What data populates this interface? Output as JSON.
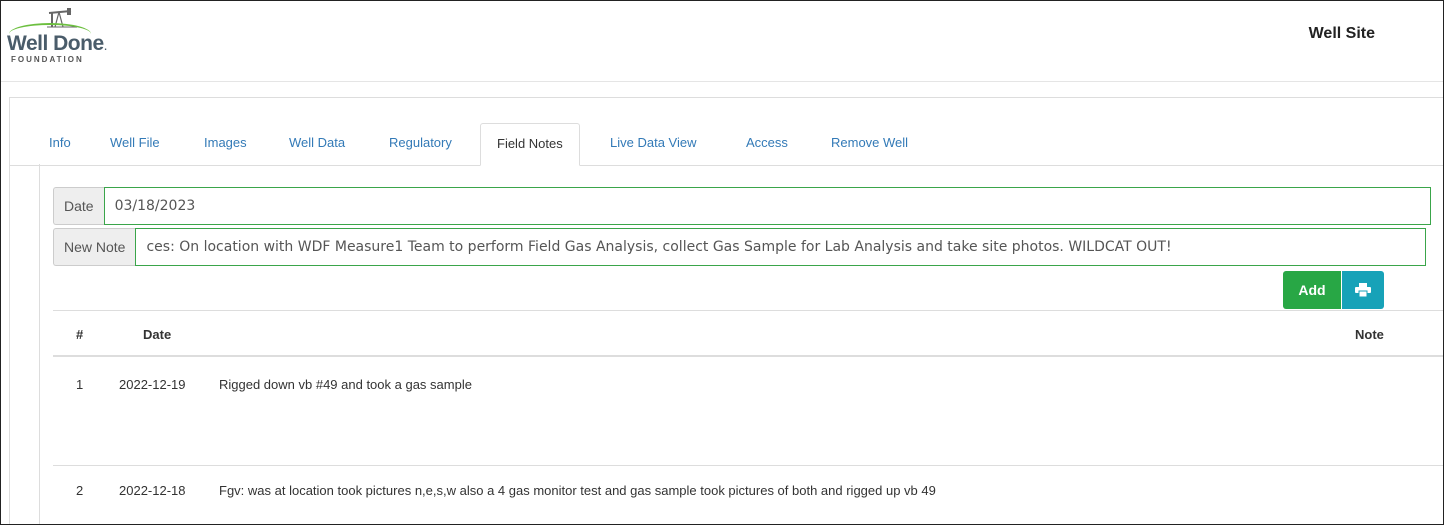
{
  "header": {
    "logo_name": "Well Done",
    "logo_suffix": ".",
    "logo_sub": "FOUNDATION",
    "site_title": "Well Site"
  },
  "tabs": [
    {
      "label": "Info"
    },
    {
      "label": "Well File"
    },
    {
      "label": "Images"
    },
    {
      "label": "Well Data"
    },
    {
      "label": "Regulatory"
    },
    {
      "label": "Field Notes",
      "active": true
    },
    {
      "label": "Live Data View"
    },
    {
      "label": "Access"
    },
    {
      "label": "Remove Well"
    }
  ],
  "form": {
    "date_label": "Date",
    "date_value": "03/18/2023",
    "note_label": "New Note",
    "note_value": "ces: On location with WDF Measure1 Team to perform Field Gas Analysis, collect Gas Sample for Lab Analysis and take site photos. WILDCAT OUT!",
    "add_label": "Add",
    "print_icon": "print-icon"
  },
  "table": {
    "headers": {
      "num": "#",
      "date": "Date",
      "note": "Note"
    },
    "rows": [
      {
        "num": "1",
        "date": "2022-12-19",
        "note": "Rigged down vb #49 and took a gas sample"
      },
      {
        "num": "2",
        "date": "2022-12-18",
        "note": "Fgv: was at location took pictures n,e,s,w also a 4 gas monitor test and gas sample took pictures of both and rigged up vb 49"
      }
    ]
  },
  "colors": {
    "accent_link": "#337ab7",
    "add_button": "#28a745",
    "print_button": "#17a2b8",
    "focus_border": "#3aa54a"
  }
}
